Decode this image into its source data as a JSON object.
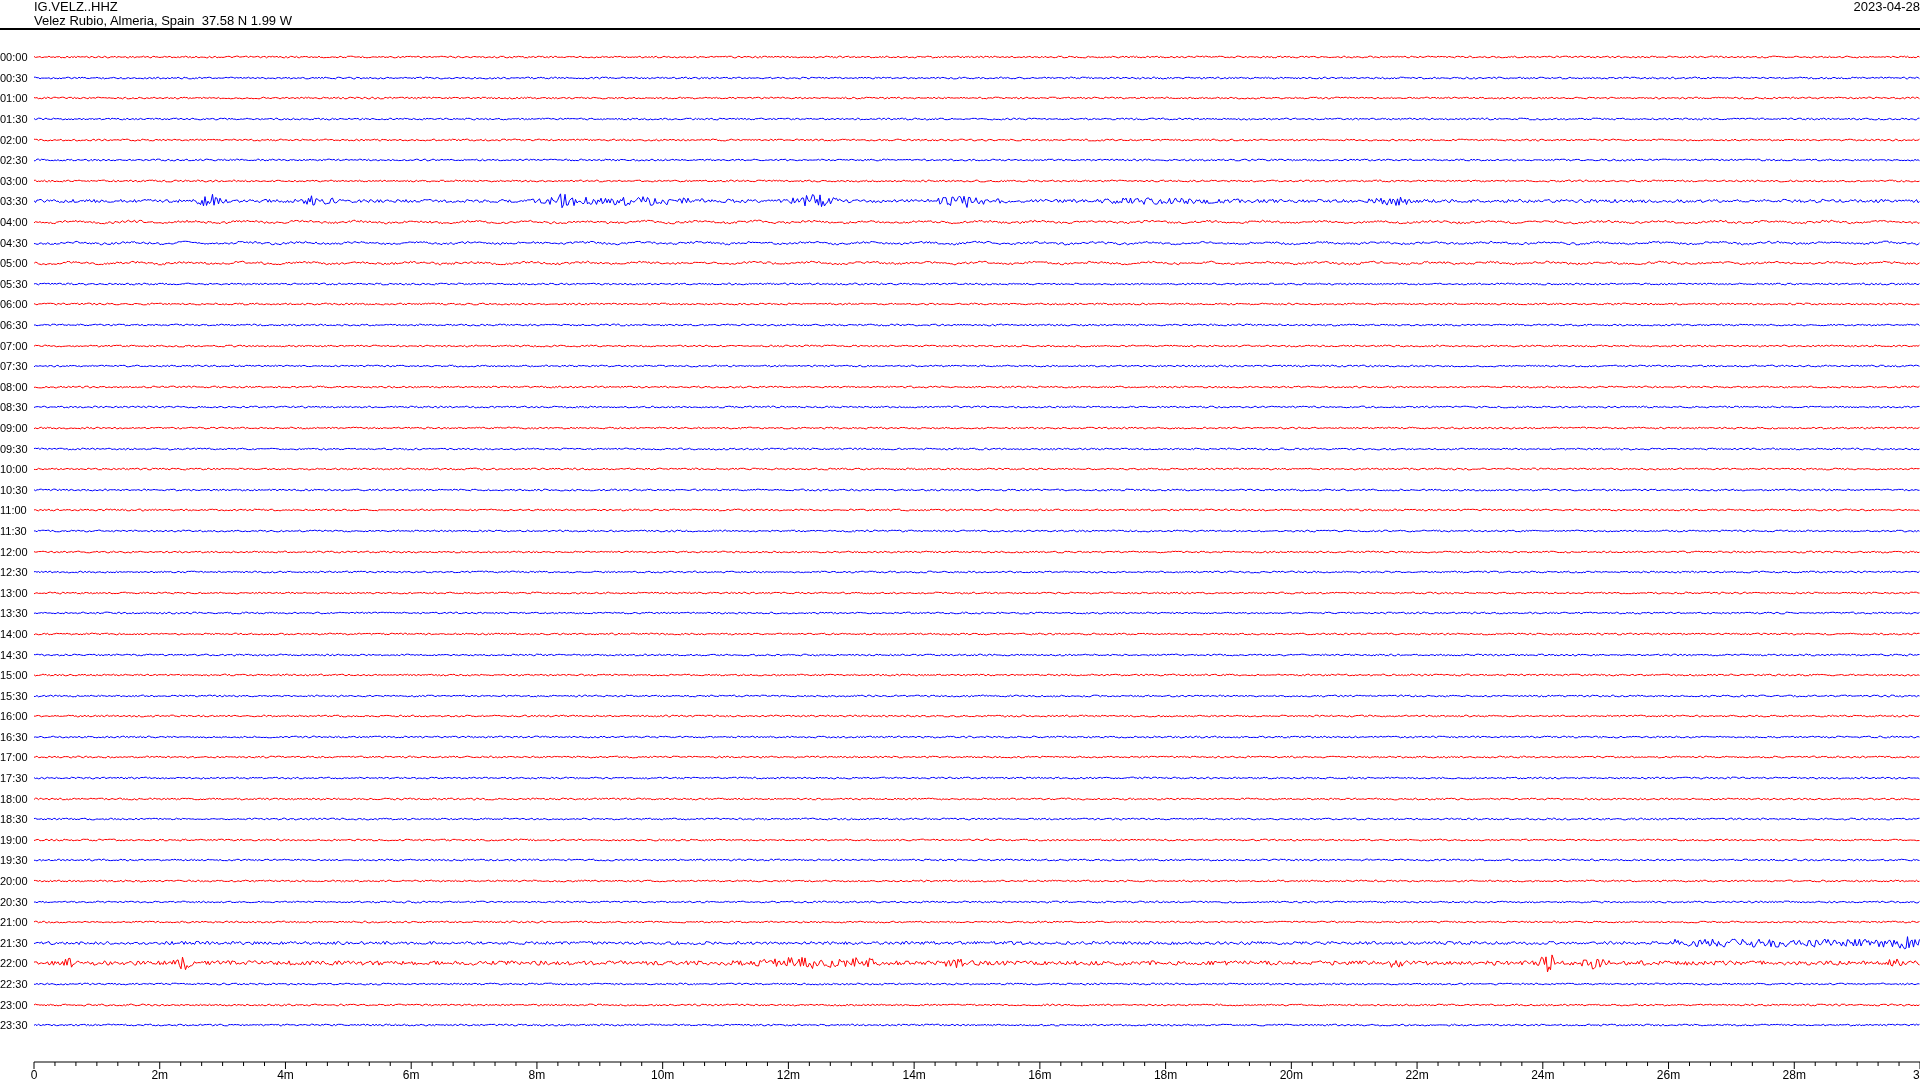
{
  "header": {
    "station": "IG.VELZ..HHZ",
    "location": "Velez Rubio, Almeria, Spain  37.58 N 1.99 W",
    "date": "2023-04-28"
  },
  "traces": [
    {
      "time": "00:00",
      "color": "#ff0000",
      "kind": "quiet"
    },
    {
      "time": "00:30",
      "color": "#0000ff",
      "kind": "quiet"
    },
    {
      "time": "01:00",
      "color": "#ff0000",
      "kind": "quiet"
    },
    {
      "time": "01:30",
      "color": "#0000ff",
      "kind": "quiet"
    },
    {
      "time": "02:00",
      "color": "#ff0000",
      "kind": "quiet"
    },
    {
      "time": "02:30",
      "color": "#0000ff",
      "kind": "quiet"
    },
    {
      "time": "03:00",
      "color": "#ff0000",
      "kind": "quiet"
    },
    {
      "time": "03:30",
      "color": "#0000ff",
      "kind": "quake"
    },
    {
      "time": "04:00",
      "color": "#ff0000",
      "kind": "swell"
    },
    {
      "time": "04:30",
      "color": "#0000ff",
      "kind": "swell"
    },
    {
      "time": "05:00",
      "color": "#ff0000",
      "kind": "swell"
    },
    {
      "time": "05:30",
      "color": "#0000ff",
      "kind": "quiet"
    },
    {
      "time": "06:00",
      "color": "#ff0000",
      "kind": "quiet"
    },
    {
      "time": "06:30",
      "color": "#0000ff",
      "kind": "quiet"
    },
    {
      "time": "07:00",
      "color": "#ff0000",
      "kind": "quiet"
    },
    {
      "time": "07:30",
      "color": "#0000ff",
      "kind": "quiet"
    },
    {
      "time": "08:00",
      "color": "#ff0000",
      "kind": "quiet"
    },
    {
      "time": "08:30",
      "color": "#0000ff",
      "kind": "quiet"
    },
    {
      "time": "09:00",
      "color": "#ff0000",
      "kind": "quiet"
    },
    {
      "time": "09:30",
      "color": "#0000ff",
      "kind": "quiet"
    },
    {
      "time": "10:00",
      "color": "#ff0000",
      "kind": "quiet"
    },
    {
      "time": "10:30",
      "color": "#0000ff",
      "kind": "quiet"
    },
    {
      "time": "11:00",
      "color": "#ff0000",
      "kind": "quiet"
    },
    {
      "time": "11:30",
      "color": "#0000ff",
      "kind": "quiet"
    },
    {
      "time": "12:00",
      "color": "#ff0000",
      "kind": "quiet"
    },
    {
      "time": "12:30",
      "color": "#0000ff",
      "kind": "quiet"
    },
    {
      "time": "13:00",
      "color": "#ff0000",
      "kind": "quiet"
    },
    {
      "time": "13:30",
      "color": "#0000ff",
      "kind": "quiet"
    },
    {
      "time": "14:00",
      "color": "#ff0000",
      "kind": "quiet"
    },
    {
      "time": "14:30",
      "color": "#0000ff",
      "kind": "quiet"
    },
    {
      "time": "15:00",
      "color": "#ff0000",
      "kind": "quiet"
    },
    {
      "time": "15:30",
      "color": "#0000ff",
      "kind": "quiet"
    },
    {
      "time": "16:00",
      "color": "#ff0000",
      "kind": "quiet"
    },
    {
      "time": "16:30",
      "color": "#0000ff",
      "kind": "quiet"
    },
    {
      "time": "17:00",
      "color": "#ff0000",
      "kind": "quiet"
    },
    {
      "time": "17:30",
      "color": "#0000ff",
      "kind": "quiet"
    },
    {
      "time": "18:00",
      "color": "#ff0000",
      "kind": "quiet"
    },
    {
      "time": "18:30",
      "color": "#0000ff",
      "kind": "quiet"
    },
    {
      "time": "19:00",
      "color": "#ff0000",
      "kind": "quiet"
    },
    {
      "time": "19:30",
      "color": "#0000ff",
      "kind": "quiet"
    },
    {
      "time": "20:00",
      "color": "#ff0000",
      "kind": "quiet"
    },
    {
      "time": "20:30",
      "color": "#0000ff",
      "kind": "quiet"
    },
    {
      "time": "21:00",
      "color": "#ff0000",
      "kind": "quiet"
    },
    {
      "time": "21:30",
      "color": "#0000ff",
      "kind": "rising"
    },
    {
      "time": "22:00",
      "color": "#ff0000",
      "kind": "noisy"
    },
    {
      "time": "22:30",
      "color": "#0000ff",
      "kind": "quiet"
    },
    {
      "time": "23:00",
      "color": "#ff0000",
      "kind": "quiet"
    },
    {
      "time": "23:30",
      "color": "#0000ff",
      "kind": "quiet"
    }
  ],
  "time_axis": {
    "labels": [
      "0",
      "2m",
      "4m",
      "6m",
      "8m",
      "10m",
      "12m",
      "14m",
      "16m",
      "18m",
      "20m",
      "22m",
      "24m",
      "26m",
      "28m",
      "3"
    ]
  }
}
